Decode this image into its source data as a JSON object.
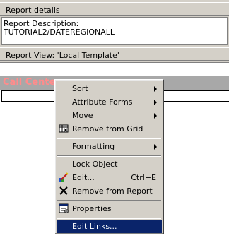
{
  "report_details": {
    "header": "Report details",
    "description_label": "Report Description:",
    "description_value": "TUTORIAL2/DATEREGIONALL"
  },
  "report_view": {
    "header": "Report View: 'Local Template'",
    "grid_title": "Call Cente"
  },
  "context_menu": {
    "items": [
      {
        "label": "Sort",
        "submenu": true
      },
      {
        "label": "Attribute Forms",
        "submenu": true
      },
      {
        "label": "Move",
        "submenu": true
      },
      {
        "label": "Remove from Grid",
        "icon": "remove-from-grid-icon"
      },
      {
        "label": "Formatting",
        "submenu": true
      },
      {
        "label": "Lock Object"
      },
      {
        "label": "Edit...",
        "shortcut": "Ctrl+E",
        "icon": "edit-pencil-icon"
      },
      {
        "label": "Remove from Report",
        "icon": "remove-x-icon"
      },
      {
        "label": "Properties",
        "icon": "properties-icon"
      },
      {
        "label": "Edit Links...",
        "selected": true
      }
    ]
  }
}
